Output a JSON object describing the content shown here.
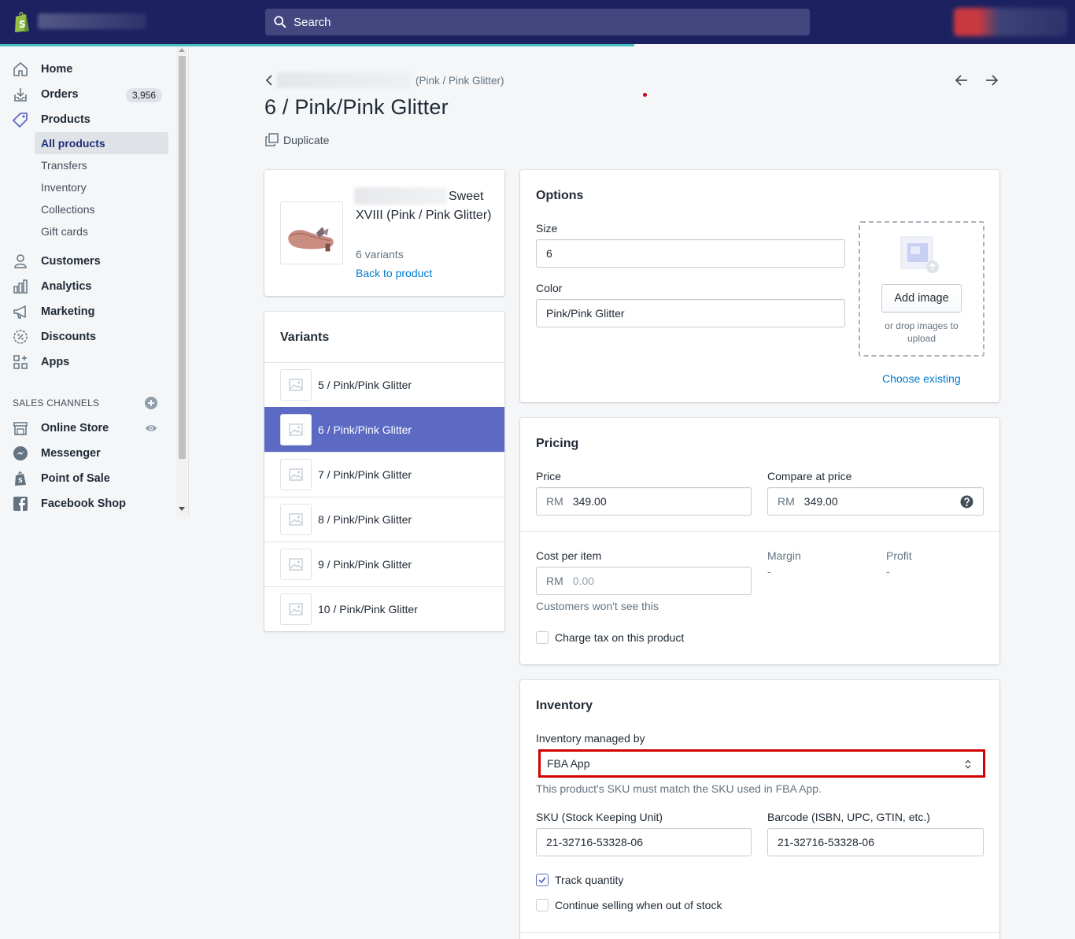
{
  "topbar": {
    "search_placeholder": "Search"
  },
  "sidebar": {
    "nav": [
      {
        "label": "Home",
        "icon": "home-icon"
      },
      {
        "label": "Orders",
        "icon": "orders-icon",
        "badge": "3,956"
      },
      {
        "label": "Products",
        "icon": "tag-icon"
      }
    ],
    "products_sub": [
      "All products",
      "Transfers",
      "Inventory",
      "Collections",
      "Gift cards"
    ],
    "nav2": [
      {
        "label": "Customers",
        "icon": "person-icon"
      },
      {
        "label": "Analytics",
        "icon": "bar-chart-icon"
      },
      {
        "label": "Marketing",
        "icon": "megaphone-icon"
      },
      {
        "label": "Discounts",
        "icon": "discount-icon"
      },
      {
        "label": "Apps",
        "icon": "apps-icon"
      }
    ],
    "sales_channels_title": "SALES CHANNELS",
    "channels": [
      {
        "label": "Online Store",
        "icon": "store-icon"
      },
      {
        "label": "Messenger",
        "icon": "messenger-icon"
      },
      {
        "label": "Point of Sale",
        "icon": "shopify-bag-icon"
      },
      {
        "label": "Facebook Shop",
        "icon": "facebook-icon"
      }
    ]
  },
  "header": {
    "breadcrumb_suffix": "(Pink / Pink Glitter)",
    "title": "6 / Pink/Pink Glitter",
    "duplicate_label": "Duplicate"
  },
  "product_summary": {
    "name": "Sweet XVIII (Pink / Pink Glitter)",
    "variants_count": "6 variants",
    "back_link": "Back to product"
  },
  "variants": {
    "title": "Variants",
    "items": [
      "5 / Pink/Pink Glitter",
      "6 / Pink/Pink Glitter",
      "7 / Pink/Pink Glitter",
      "8 / Pink/Pink Glitter",
      "9 / Pink/Pink Glitter",
      "10 / Pink/Pink Glitter"
    ],
    "selected_index": 1
  },
  "options": {
    "title": "Options",
    "size_label": "Size",
    "size_value": "6",
    "color_label": "Color",
    "color_value": "Pink/Pink Glitter",
    "add_image_label": "Add image",
    "drop_hint": "or drop images to upload",
    "choose_existing": "Choose existing"
  },
  "pricing": {
    "title": "Pricing",
    "price_label": "Price",
    "currency": "RM",
    "price_value": "349.00",
    "compare_label": "Compare at price",
    "compare_value": "349.00",
    "cost_label": "Cost per item",
    "cost_placeholder": "0.00",
    "margin_label": "Margin",
    "margin_value": "-",
    "profit_label": "Profit",
    "profit_value": "-",
    "cost_help": "Customers won't see this",
    "charge_tax_label": "Charge tax on this product",
    "charge_tax_checked": false
  },
  "inventory": {
    "title": "Inventory",
    "managed_by_label": "Inventory managed by",
    "managed_by_value": "FBA App",
    "managed_by_help": "This product's SKU must match the SKU used in FBA App.",
    "sku_label": "SKU (Stock Keeping Unit)",
    "sku_value": "21-32716-53328-06",
    "barcode_label": "Barcode (ISBN, UPC, GTIN, etc.)",
    "barcode_value": "21-32716-53328-06",
    "track_quantity_label": "Track quantity",
    "track_quantity_checked": true,
    "continue_selling_label": "Continue selling when out of stock",
    "continue_selling_checked": false
  },
  "colors": {
    "topbar": "#1c2260",
    "accent": "#5c6ac4",
    "link": "#007ace",
    "highlight_border": "#d40000"
  }
}
